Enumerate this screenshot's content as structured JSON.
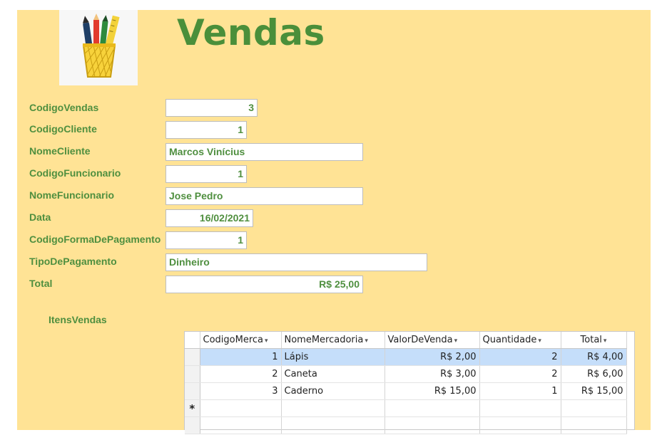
{
  "form": {
    "title": "Vendas",
    "logo_icon": "pencil-cup-icon",
    "fields": [
      {
        "key": "codigo_vendas",
        "label": "CodigoVendas",
        "value": "3"
      },
      {
        "key": "codigo_cliente",
        "label": "CodigoCliente",
        "value": "1"
      },
      {
        "key": "nome_cliente",
        "label": "NomeCliente",
        "value": "Marcos Vinícius"
      },
      {
        "key": "codigo_funcionario",
        "label": "CodigoFuncionario",
        "value": "1"
      },
      {
        "key": "nome_funcionario",
        "label": "NomeFuncionario",
        "value": "Jose Pedro"
      },
      {
        "key": "data",
        "label": "Data",
        "value": "16/02/2021"
      },
      {
        "key": "codigo_forma_pagamento",
        "label": "CodigoFormaDePagamento",
        "value": "1"
      },
      {
        "key": "tipo_pagamento",
        "label": "TipoDePagamento",
        "value": "Dinheiro"
      },
      {
        "key": "total",
        "label": "Total",
        "value": "R$ 25,00"
      }
    ],
    "accent_color": "#4f8f3f",
    "background_color": "#ffe395"
  },
  "subform": {
    "label": "ItensVendas",
    "columns": [
      "CodigoMerca",
      "NomeMercadoria",
      "ValorDeVenda",
      "Quantidade",
      "Total"
    ],
    "rows": [
      {
        "codigo": "1",
        "nome": "Lápis",
        "valor": "R$ 2,00",
        "quantidade": "2",
        "total": "R$ 4,00"
      },
      {
        "codigo": "2",
        "nome": "Caneta",
        "valor": "R$ 3,00",
        "quantidade": "2",
        "total": "R$ 6,00"
      },
      {
        "codigo": "3",
        "nome": "Caderno",
        "valor": "R$ 15,00",
        "quantidade": "1",
        "total": "R$ 15,00"
      }
    ],
    "new_record_marker": "*",
    "selected_row": 0
  }
}
